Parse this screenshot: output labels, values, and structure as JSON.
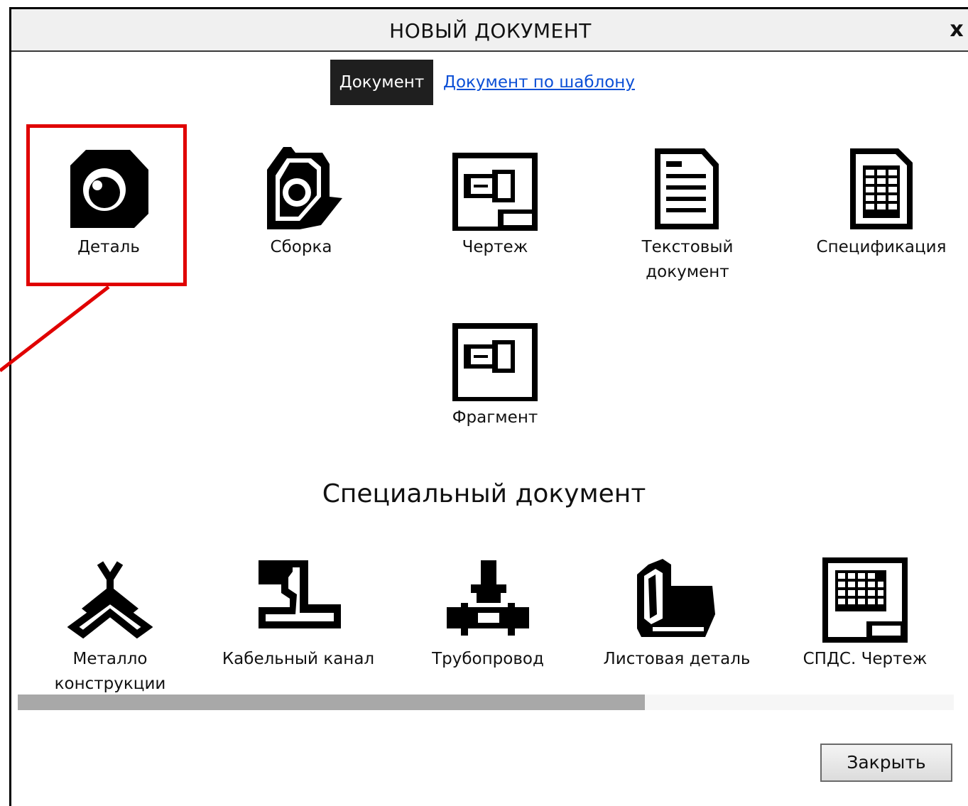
{
  "dialog": {
    "title": "НОВЫЙ ДОКУМЕНТ",
    "close_symbol": "x"
  },
  "tabs": {
    "active": "Документ",
    "link": "Документ по шаблону"
  },
  "documents": [
    {
      "label": "Деталь",
      "icon": "part-icon"
    },
    {
      "label": "Сборка",
      "icon": "assembly-icon"
    },
    {
      "label": "Чертеж",
      "icon": "drawing-icon"
    },
    {
      "label": "Текстовый\nдокумент",
      "icon": "text-document-icon"
    },
    {
      "label": "Спецификация",
      "icon": "specification-icon"
    },
    {
      "label": "Фрагмент",
      "icon": "fragment-icon"
    }
  ],
  "special_section": {
    "title": "Специальный документ",
    "items": [
      {
        "label": "Металло\nконструкции",
        "icon": "metal-structures-icon"
      },
      {
        "label": "Кабельный канал",
        "icon": "cable-channel-icon"
      },
      {
        "label": "Трубопровод",
        "icon": "pipeline-icon"
      },
      {
        "label": "Листовая деталь",
        "icon": "sheet-part-icon"
      },
      {
        "label": "СПДС. Чертеж",
        "icon": "spds-drawing-icon"
      }
    ]
  },
  "scrollbar": {
    "thumb_fraction": 0.67
  },
  "buttons": {
    "close_label": "Закрыть"
  },
  "colors": {
    "highlight": "#e00000",
    "link": "#0b4fd6",
    "active_tab": "#1f1f1f"
  }
}
